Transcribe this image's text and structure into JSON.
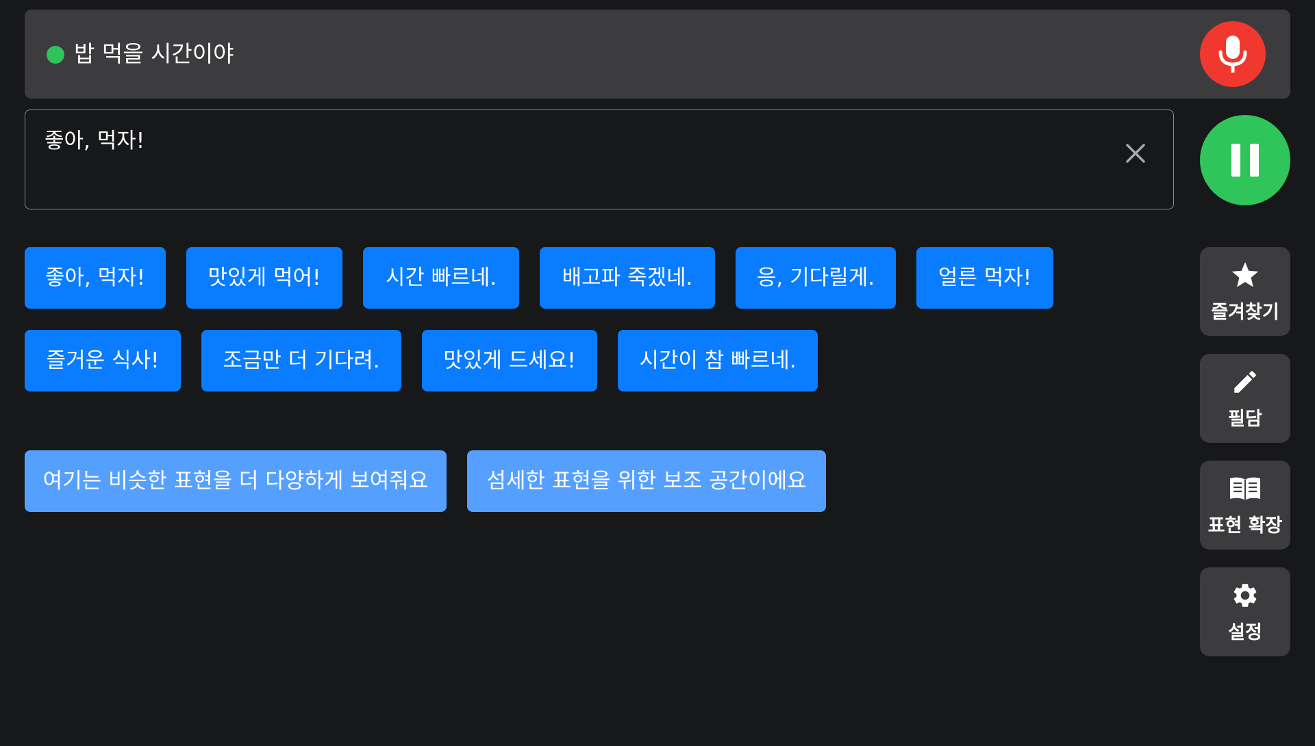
{
  "colors": {
    "background": "#17181a",
    "panel": "#3c3c3e",
    "status_dot": "#2fc35a",
    "mic_button": "#f1382f",
    "pause_button": "#30c55a",
    "chip_primary": "#0a7cff",
    "chip_light": "#55a0ff"
  },
  "header": {
    "status_icon": "green-dot",
    "heard_text": "밥 먹을 시간이야",
    "mic_icon": "microphone-icon"
  },
  "reply": {
    "value": "좋아, 먹자!",
    "clear_icon": "close-icon"
  },
  "pause_icon": "pause-icon",
  "suggestions": [
    "좋아, 먹자!",
    "맛있게 먹어!",
    "시간 빠르네.",
    "배고파 죽겠네.",
    "응, 기다릴게.",
    "얼른 먹자!",
    "즐거운 식사!",
    "조금만 더 기다려.",
    "맛있게 드세요!",
    "시간이 참 빠르네."
  ],
  "expansions": [
    "여기는 비슷한 표현을 더 다양하게 보여줘요",
    "섬세한 표현을 위한 보조 공간이에요"
  ],
  "tools": [
    {
      "label": "즐겨찾기",
      "icon": "star-icon"
    },
    {
      "label": "필담",
      "icon": "pencil-icon"
    },
    {
      "label": "표현 확장",
      "icon": "book-icon"
    },
    {
      "label": "설정",
      "icon": "gear-icon"
    }
  ]
}
